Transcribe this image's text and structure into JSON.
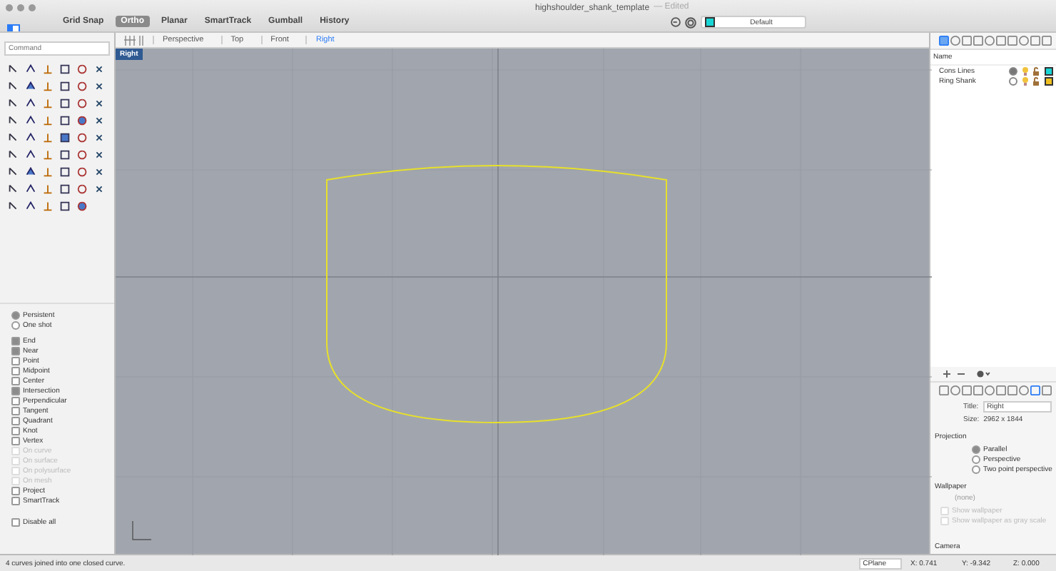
{
  "window": {
    "title": "highshoulder_shank_template",
    "edited": "— Edited"
  },
  "modes": [
    {
      "label": "Grid Snap",
      "selected": false
    },
    {
      "label": "Ortho",
      "selected": true
    },
    {
      "label": "Planar",
      "selected": false
    },
    {
      "label": "SmartTrack",
      "selected": false
    },
    {
      "label": "Gumball",
      "selected": false
    },
    {
      "label": "History",
      "selected": false
    }
  ],
  "layer_field": {
    "value": "Default",
    "color": "#19d6d6"
  },
  "viewport_tabs": [
    {
      "label": "Perspective",
      "selected": false
    },
    {
      "label": "Top",
      "selected": false
    },
    {
      "label": "Front",
      "selected": false
    },
    {
      "label": "Right",
      "selected": true
    }
  ],
  "viewport": {
    "label": "Right"
  },
  "command": {
    "placeholder": "Command"
  },
  "osnap_mode": [
    {
      "label": "Persistent",
      "selected": true
    },
    {
      "label": "One shot",
      "selected": false
    }
  ],
  "osnaps": [
    {
      "label": "End",
      "checked": true,
      "disabled": false
    },
    {
      "label": "Near",
      "checked": true,
      "disabled": false
    },
    {
      "label": "Point",
      "checked": false,
      "disabled": false
    },
    {
      "label": "Midpoint",
      "checked": false,
      "disabled": false
    },
    {
      "label": "Center",
      "checked": false,
      "disabled": false
    },
    {
      "label": "Intersection",
      "checked": true,
      "disabled": false
    },
    {
      "label": "Perpendicular",
      "checked": false,
      "disabled": false
    },
    {
      "label": "Tangent",
      "checked": false,
      "disabled": false
    },
    {
      "label": "Quadrant",
      "checked": false,
      "disabled": false
    },
    {
      "label": "Knot",
      "checked": false,
      "disabled": false
    },
    {
      "label": "Vertex",
      "checked": false,
      "disabled": false
    },
    {
      "label": "On curve",
      "checked": false,
      "disabled": true
    },
    {
      "label": "On surface",
      "checked": false,
      "disabled": true
    },
    {
      "label": "On polysurface",
      "checked": false,
      "disabled": true
    },
    {
      "label": "On mesh",
      "checked": false,
      "disabled": true
    },
    {
      "label": "Project",
      "checked": false,
      "disabled": false
    },
    {
      "label": "SmartTrack",
      "checked": false,
      "disabled": false
    }
  ],
  "disable_all": {
    "label": "Disable all",
    "checked": false
  },
  "layers": {
    "column": "Name",
    "rows": [
      {
        "name": "Cons Lines",
        "current": true,
        "color": "#19d6d6"
      },
      {
        "name": "Ring Shank",
        "current": false,
        "color": "#f0c020"
      }
    ]
  },
  "properties": {
    "title_label": "Title:",
    "title_value": "Right",
    "size_label": "Size:",
    "size_value": "2962 x 1844",
    "projection_heading": "Projection",
    "projections": [
      {
        "label": "Parallel",
        "selected": true
      },
      {
        "label": "Perspective",
        "selected": false
      },
      {
        "label": "Two point perspective",
        "selected": false
      }
    ],
    "wallpaper_heading": "Wallpaper",
    "wallpaper_name": "(none)",
    "wallpaper_options": [
      {
        "label": "Show wallpaper",
        "checked": false,
        "disabled": true
      },
      {
        "label": "Show wallpaper as gray scale",
        "checked": false,
        "disabled": true
      }
    ],
    "camera_heading": "Camera"
  },
  "status_bar": {
    "message": "4 curves joined into one closed curve.",
    "cplane": "CPlane",
    "x": "X: 0.741",
    "y": "Y: -9.342",
    "z": "Z: 0.000"
  }
}
